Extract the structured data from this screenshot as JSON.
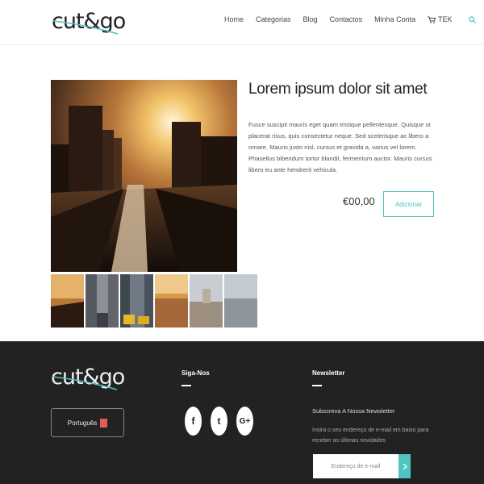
{
  "header": {
    "logo_text": "cut&go",
    "nav": [
      "Home",
      "Categorias",
      "Blog",
      "Contactos",
      "Minha Conta"
    ],
    "cart_label": "TEK",
    "icons": [
      "cart-icon",
      "search-icon"
    ]
  },
  "product": {
    "title": "Lorem ipsum dolor sit amet",
    "description": "Fusce suscipit mauris eget quam tristique pellentesque. Quisque ut placerat risus, quis consectetur neque. Sed scelerisque ac libero a ornare. Mauris justo nisl, cursus et gravida a, varius vel lorem. Phasellus bibendum tortor blandit, fermentum auctor. Mauris cursus libero eu ante hendrerit vehicula.",
    "price": "€00,00",
    "add_label": "Adicionar"
  },
  "footer": {
    "logo_text": "cut&go",
    "language": "Português",
    "follow_heading": "Siga-Nos",
    "social": [
      "f",
      "t",
      "G+"
    ],
    "newsletter_heading": "Newsletter",
    "newsletter_sub": "Subscreva A Nossa Newsletter",
    "newsletter_text": "Insira o seu endereço de e-mail em baixo para receber as últimas novidades",
    "email_placeholder": "Endereço de e-mail",
    "accent_color": "#4ec5c1"
  }
}
